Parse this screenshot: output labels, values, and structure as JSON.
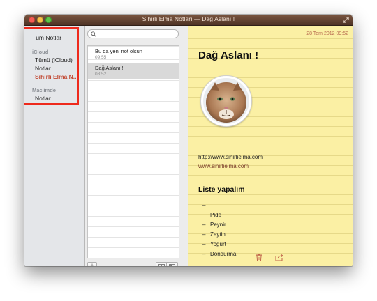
{
  "window": {
    "title": "Sihirli Elma Notları — Dağ Aslanı !"
  },
  "sidebar": {
    "all_notes": "Tüm Notlar",
    "icloud_header": "iCloud",
    "icloud_items": [
      "Tümü (iCloud)",
      "Notlar",
      "Sihirli Elma N..."
    ],
    "mac_header": "Mac'imde",
    "mac_items": [
      "Notlar"
    ]
  },
  "notelist": {
    "search": {
      "placeholder": ""
    },
    "notes": [
      {
        "title": "Bu da yeni not olsun",
        "time": "09:55"
      },
      {
        "title": "Dağ Aslanı !",
        "time": "08:52"
      }
    ],
    "add_label": "+"
  },
  "note": {
    "date": "28 Tem 2012 09:52",
    "heading": "Dağ Aslanı !",
    "url_text": "http://www.sihirlielma.com",
    "link_text": "www.sihirlielma.com",
    "list_title": "Liste yapalım",
    "list_items": [
      {
        "dash": "–",
        "text": ""
      },
      {
        "dash": "",
        "text": "Pide"
      },
      {
        "dash": "–",
        "text": "Peynir"
      },
      {
        "dash": "–",
        "text": "Zeytin"
      },
      {
        "dash": "–",
        "text": "Yoğurt"
      },
      {
        "dash": "–",
        "text": "Dondurma"
      }
    ]
  },
  "colors": {
    "highlight": "#ee2a1c",
    "selected_folder": "#c24b36",
    "paper": "#fbf0a4",
    "titlebar": "#5e3e2e"
  },
  "icons": [
    "search-icon",
    "trash-icon",
    "share-icon",
    "fullscreen-icon",
    "cougar-avatar"
  ]
}
